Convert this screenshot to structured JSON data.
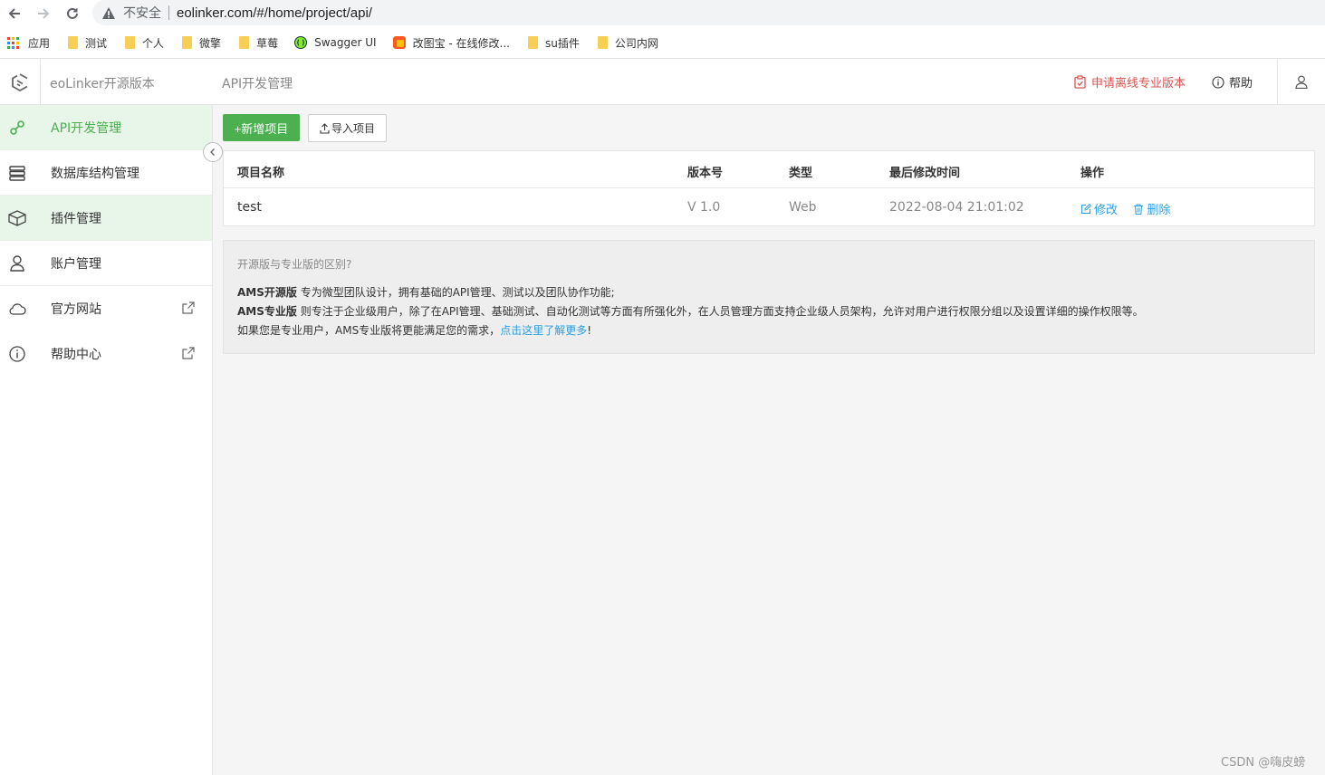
{
  "browser": {
    "security_label": "不安全",
    "url": "eolinker.com/#/home/project/api/",
    "bookmarks": [
      {
        "label": "应用",
        "icon": "apps-grid-icon"
      },
      {
        "label": "测试",
        "icon": "folder-icon"
      },
      {
        "label": "个人",
        "icon": "folder-icon"
      },
      {
        "label": "微擎",
        "icon": "folder-icon"
      },
      {
        "label": "草莓",
        "icon": "folder-icon"
      },
      {
        "label": "Swagger UI",
        "icon": "swagger-icon"
      },
      {
        "label": "改图宝 - 在线修改...",
        "icon": "gaitubao-icon"
      },
      {
        "label": "su插件",
        "icon": "folder-icon"
      },
      {
        "label": "公司内网",
        "icon": "folder-icon"
      }
    ]
  },
  "header": {
    "brand": "eoLinker开源版本",
    "section_title": "API开发管理",
    "apply_label": "申请离线专业版本",
    "help_label": "帮助"
  },
  "sidebar": {
    "items": [
      {
        "label": "API开发管理",
        "icon": "link-icon"
      },
      {
        "label": "数据库结构管理",
        "icon": "database-icon"
      },
      {
        "label": "插件管理",
        "icon": "cube-icon"
      },
      {
        "label": "账户管理",
        "icon": "user-icon"
      },
      {
        "label": "官方网站",
        "icon": "cloud-icon"
      },
      {
        "label": "帮助中心",
        "icon": "info-icon"
      }
    ]
  },
  "toolbar": {
    "add_label": "+新增项目",
    "import_label": "导入项目"
  },
  "table": {
    "columns": [
      "项目名称",
      "版本号",
      "类型",
      "最后修改时间",
      "操作"
    ],
    "rows": [
      {
        "name": "test",
        "version": "V 1.0",
        "type": "Web",
        "modified": "2022-08-04 21:01:02",
        "edit": "修改",
        "delete": "删除"
      }
    ]
  },
  "info": {
    "title": "开源版与专业版的区别?",
    "line1_bold": "AMS开源版",
    "line1_text": " 专为微型团队设计，拥有基础的API管理、测试以及团队协作功能;",
    "line2_bold": "AMS专业版",
    "line2_text": " 则专注于企业级用户，除了在API管理、基础测试、自动化测试等方面有所强化外，在人员管理方面支持企业级人员架构，允许对用户进行权限分组以及设置详细的操作权限等。",
    "line3_text": "如果您是专业用户，AMS专业版将更能满足您的需求，",
    "line3_link": "点击这里了解更多",
    "line3_end": "!"
  },
  "watermark": "CSDN @嗨皮螃",
  "colors": {
    "accent_green": "#4caf50",
    "active_bg": "#e8f5e9",
    "link_blue": "#2d9fe0",
    "apply_red": "#d9534f"
  }
}
